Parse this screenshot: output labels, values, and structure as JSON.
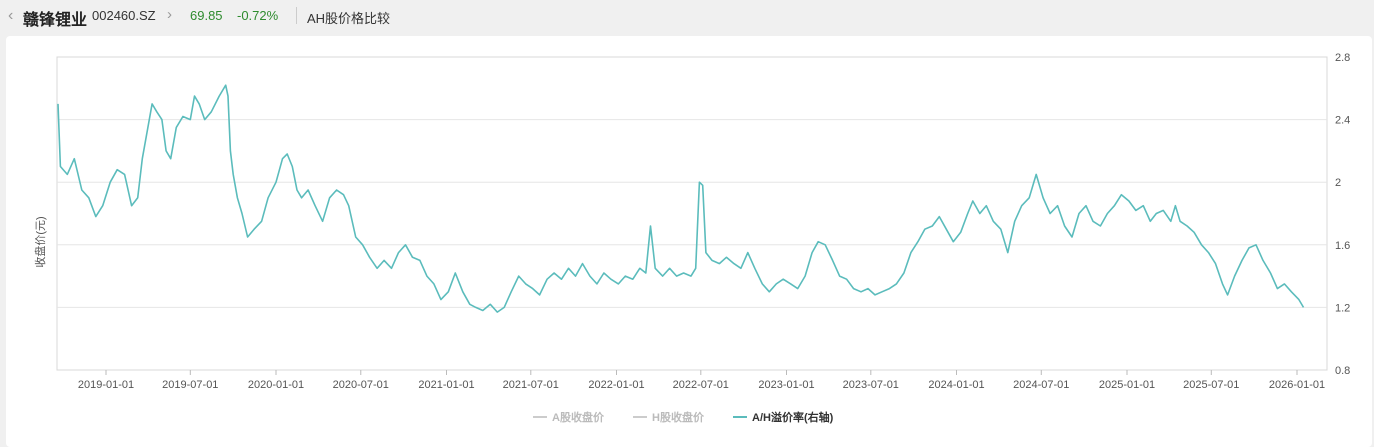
{
  "header": {
    "back_icon": "chevron-left-icon",
    "stock_name": "赣锋锂业",
    "stock_code": "002460.SZ",
    "chevron_icon": "chevron-right-icon",
    "price": "69.85",
    "change": "-0.72%",
    "page_title": "AH股价格比较",
    "colors": {
      "down": "#2e8b2e"
    }
  },
  "chart_data": {
    "type": "line",
    "title": "",
    "ylabel": "收盘价(元)",
    "y2lim": [
      0.8,
      2.8
    ],
    "y2ticks": [
      "0.8",
      "1.2",
      "1.6",
      "2",
      "2.4",
      "2.8"
    ],
    "xlabels": [
      "2019-01-01",
      "2019-07-01",
      "2020-01-01",
      "2020-07-01",
      "2021-01-01",
      "2021-07-01",
      "2022-01-01",
      "2022-07-01",
      "2023-01-01",
      "2023-07-01",
      "2024-01-01",
      "2024-07-01",
      "2025-01-01",
      "2025-07-01",
      "2026-01-01"
    ],
    "grid": "horizontal",
    "legend_position": "bottom",
    "series": [
      {
        "name": "A股收盘价",
        "color": "#cccccc",
        "visible": false,
        "values": []
      },
      {
        "name": "H股收盘价",
        "color": "#cccccc",
        "visible": false,
        "values": []
      },
      {
        "name": "A/H溢价率(右轴)",
        "color": "#5bbcbc",
        "axis": "right",
        "visible": true,
        "points": [
          [
            "2018-09-20",
            2.5
          ],
          [
            "2018-09-25",
            2.1
          ],
          [
            "2018-10-10",
            2.05
          ],
          [
            "2018-10-25",
            2.15
          ],
          [
            "2018-11-10",
            1.95
          ],
          [
            "2018-11-25",
            1.9
          ],
          [
            "2018-12-10",
            1.78
          ],
          [
            "2018-12-25",
            1.85
          ],
          [
            "2019-01-10",
            2.0
          ],
          [
            "2019-01-25",
            2.08
          ],
          [
            "2019-02-10",
            2.05
          ],
          [
            "2019-02-25",
            1.85
          ],
          [
            "2019-03-10",
            1.9
          ],
          [
            "2019-03-20",
            2.15
          ],
          [
            "2019-04-01",
            2.35
          ],
          [
            "2019-04-10",
            2.5
          ],
          [
            "2019-04-20",
            2.45
          ],
          [
            "2019-05-01",
            2.4
          ],
          [
            "2019-05-10",
            2.2
          ],
          [
            "2019-05-20",
            2.15
          ],
          [
            "2019-06-01",
            2.35
          ],
          [
            "2019-06-15",
            2.42
          ],
          [
            "2019-07-01",
            2.4
          ],
          [
            "2019-07-10",
            2.55
          ],
          [
            "2019-07-20",
            2.5
          ],
          [
            "2019-08-01",
            2.4
          ],
          [
            "2019-08-15",
            2.45
          ],
          [
            "2019-09-01",
            2.55
          ],
          [
            "2019-09-15",
            2.62
          ],
          [
            "2019-09-20",
            2.55
          ],
          [
            "2019-09-25",
            2.2
          ],
          [
            "2019-10-01",
            2.05
          ],
          [
            "2019-10-10",
            1.9
          ],
          [
            "2019-10-20",
            1.8
          ],
          [
            "2019-11-01",
            1.65
          ],
          [
            "2019-11-15",
            1.7
          ],
          [
            "2019-12-01",
            1.75
          ],
          [
            "2019-12-15",
            1.9
          ],
          [
            "2020-01-01",
            2.0
          ],
          [
            "2020-01-15",
            2.15
          ],
          [
            "2020-01-25",
            2.18
          ],
          [
            "2020-02-05",
            2.1
          ],
          [
            "2020-02-15",
            1.95
          ],
          [
            "2020-02-25",
            1.9
          ],
          [
            "2020-03-10",
            1.95
          ],
          [
            "2020-03-25",
            1.85
          ],
          [
            "2020-04-10",
            1.75
          ],
          [
            "2020-04-25",
            1.9
          ],
          [
            "2020-05-10",
            1.95
          ],
          [
            "2020-05-25",
            1.92
          ],
          [
            "2020-06-05",
            1.85
          ],
          [
            "2020-06-20",
            1.65
          ],
          [
            "2020-07-05",
            1.6
          ],
          [
            "2020-07-20",
            1.52
          ],
          [
            "2020-08-05",
            1.45
          ],
          [
            "2020-08-20",
            1.5
          ],
          [
            "2020-09-05",
            1.45
          ],
          [
            "2020-09-20",
            1.55
          ],
          [
            "2020-10-05",
            1.6
          ],
          [
            "2020-10-20",
            1.52
          ],
          [
            "2020-11-05",
            1.5
          ],
          [
            "2020-11-20",
            1.4
          ],
          [
            "2020-12-05",
            1.35
          ],
          [
            "2020-12-20",
            1.25
          ],
          [
            "2021-01-05",
            1.3
          ],
          [
            "2021-01-20",
            1.42
          ],
          [
            "2021-02-05",
            1.3
          ],
          [
            "2021-02-20",
            1.22
          ],
          [
            "2021-03-05",
            1.2
          ],
          [
            "2021-03-20",
            1.18
          ],
          [
            "2021-04-05",
            1.22
          ],
          [
            "2021-04-20",
            1.17
          ],
          [
            "2021-05-05",
            1.2
          ],
          [
            "2021-05-20",
            1.3
          ],
          [
            "2021-06-05",
            1.4
          ],
          [
            "2021-06-20",
            1.35
          ],
          [
            "2021-07-05",
            1.32
          ],
          [
            "2021-07-20",
            1.28
          ],
          [
            "2021-08-05",
            1.38
          ],
          [
            "2021-08-20",
            1.42
          ],
          [
            "2021-09-05",
            1.38
          ],
          [
            "2021-09-20",
            1.45
          ],
          [
            "2021-10-05",
            1.4
          ],
          [
            "2021-10-20",
            1.48
          ],
          [
            "2021-11-05",
            1.4
          ],
          [
            "2021-11-20",
            1.35
          ],
          [
            "2021-12-05",
            1.42
          ],
          [
            "2021-12-20",
            1.38
          ],
          [
            "2022-01-05",
            1.35
          ],
          [
            "2022-01-20",
            1.4
          ],
          [
            "2022-02-05",
            1.38
          ],
          [
            "2022-02-20",
            1.45
          ],
          [
            "2022-03-05",
            1.42
          ],
          [
            "2022-03-15",
            1.72
          ],
          [
            "2022-03-25",
            1.45
          ],
          [
            "2022-04-10",
            1.4
          ],
          [
            "2022-04-25",
            1.45
          ],
          [
            "2022-05-10",
            1.4
          ],
          [
            "2022-05-25",
            1.42
          ],
          [
            "2022-06-10",
            1.4
          ],
          [
            "2022-06-20",
            1.45
          ],
          [
            "2022-06-28",
            2.0
          ],
          [
            "2022-07-05",
            1.98
          ],
          [
            "2022-07-12",
            1.55
          ],
          [
            "2022-07-25",
            1.5
          ],
          [
            "2022-08-10",
            1.48
          ],
          [
            "2022-08-25",
            1.52
          ],
          [
            "2022-09-10",
            1.48
          ],
          [
            "2022-09-25",
            1.45
          ],
          [
            "2022-10-10",
            1.55
          ],
          [
            "2022-10-25",
            1.45
          ],
          [
            "2022-11-10",
            1.35
          ],
          [
            "2022-11-25",
            1.3
          ],
          [
            "2022-12-10",
            1.35
          ],
          [
            "2022-12-25",
            1.38
          ],
          [
            "2023-01-10",
            1.35
          ],
          [
            "2023-01-25",
            1.32
          ],
          [
            "2023-02-10",
            1.4
          ],
          [
            "2023-02-25",
            1.55
          ],
          [
            "2023-03-10",
            1.62
          ],
          [
            "2023-03-25",
            1.6
          ],
          [
            "2023-04-10",
            1.5
          ],
          [
            "2023-04-25",
            1.4
          ],
          [
            "2023-05-10",
            1.38
          ],
          [
            "2023-05-25",
            1.32
          ],
          [
            "2023-06-10",
            1.3
          ],
          [
            "2023-06-25",
            1.32
          ],
          [
            "2023-07-10",
            1.28
          ],
          [
            "2023-07-25",
            1.3
          ],
          [
            "2023-08-10",
            1.32
          ],
          [
            "2023-08-25",
            1.35
          ],
          [
            "2023-09-10",
            1.42
          ],
          [
            "2023-09-25",
            1.55
          ],
          [
            "2023-10-10",
            1.62
          ],
          [
            "2023-10-25",
            1.7
          ],
          [
            "2023-11-10",
            1.72
          ],
          [
            "2023-11-25",
            1.78
          ],
          [
            "2023-12-10",
            1.7
          ],
          [
            "2023-12-25",
            1.62
          ],
          [
            "2024-01-10",
            1.68
          ],
          [
            "2024-01-25",
            1.8
          ],
          [
            "2024-02-05",
            1.88
          ],
          [
            "2024-02-20",
            1.8
          ],
          [
            "2024-03-05",
            1.85
          ],
          [
            "2024-03-20",
            1.75
          ],
          [
            "2024-04-05",
            1.7
          ],
          [
            "2024-04-20",
            1.55
          ],
          [
            "2024-05-05",
            1.75
          ],
          [
            "2024-05-20",
            1.85
          ],
          [
            "2024-06-05",
            1.9
          ],
          [
            "2024-06-20",
            2.05
          ],
          [
            "2024-07-05",
            1.9
          ],
          [
            "2024-07-20",
            1.8
          ],
          [
            "2024-08-05",
            1.85
          ],
          [
            "2024-08-20",
            1.72
          ],
          [
            "2024-09-05",
            1.65
          ],
          [
            "2024-09-20",
            1.8
          ],
          [
            "2024-10-05",
            1.85
          ],
          [
            "2024-10-20",
            1.75
          ],
          [
            "2024-11-05",
            1.72
          ],
          [
            "2024-11-20",
            1.8
          ],
          [
            "2024-12-05",
            1.85
          ],
          [
            "2024-12-20",
            1.92
          ],
          [
            "2025-01-05",
            1.88
          ],
          [
            "2025-01-20",
            1.82
          ],
          [
            "2025-02-05",
            1.85
          ],
          [
            "2025-02-20",
            1.75
          ],
          [
            "2025-03-05",
            1.8
          ],
          [
            "2025-03-20",
            1.82
          ],
          [
            "2025-04-05",
            1.75
          ],
          [
            "2025-04-15",
            1.85
          ],
          [
            "2025-04-25",
            1.75
          ],
          [
            "2025-05-10",
            1.72
          ],
          [
            "2025-05-25",
            1.68
          ],
          [
            "2025-06-10",
            1.6
          ],
          [
            "2025-06-25",
            1.55
          ],
          [
            "2025-07-10",
            1.48
          ],
          [
            "2025-07-25",
            1.35
          ],
          [
            "2025-08-05",
            1.28
          ],
          [
            "2025-08-20",
            1.4
          ],
          [
            "2025-09-05",
            1.5
          ],
          [
            "2025-09-20",
            1.58
          ],
          [
            "2025-10-05",
            1.6
          ],
          [
            "2025-10-20",
            1.5
          ],
          [
            "2025-11-05",
            1.42
          ],
          [
            "2025-11-20",
            1.32
          ],
          [
            "2025-12-05",
            1.35
          ],
          [
            "2025-12-20",
            1.3
          ],
          [
            "2026-01-05",
            1.25
          ],
          [
            "2026-01-15",
            1.2
          ]
        ]
      }
    ]
  }
}
